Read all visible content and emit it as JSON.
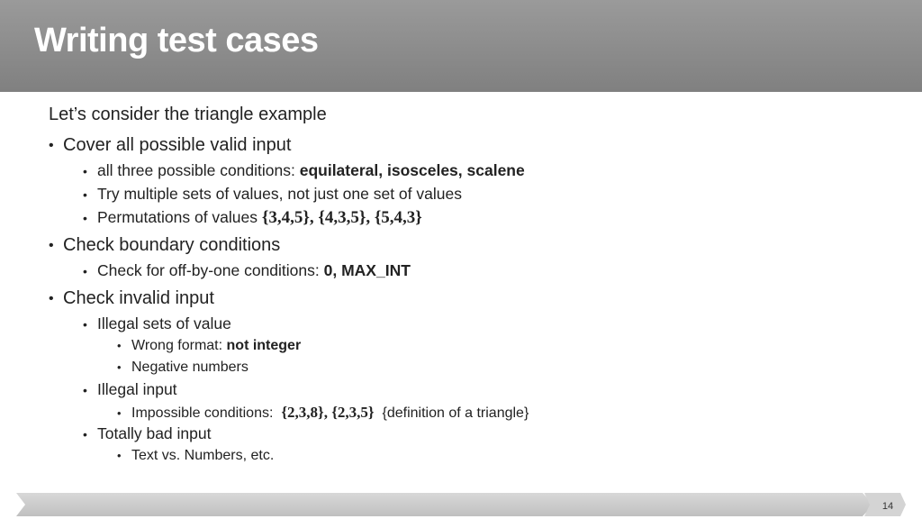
{
  "slide": {
    "title": "Writing test cases",
    "page_number": "14"
  },
  "content": {
    "intro": "Let’s consider the triangle example",
    "items": [
      {
        "text": "Cover all possible valid input"
      },
      {
        "text": "all three possible conditions: ",
        "bold": "equilateral, isosceles, scalene"
      },
      {
        "text": "Try multiple sets of values, not just one set of values"
      },
      {
        "text": "Permutations of values ",
        "bold": "{3,4,5}, {4,3,5}, {5,4,3}"
      },
      {
        "text": "Check boundary conditions"
      },
      {
        "text": "Check for off-by-one conditions: ",
        "bold": "0, MAX_INT"
      },
      {
        "text": "Check invalid input"
      },
      {
        "text": "Illegal sets of value"
      },
      {
        "text": "Wrong format: ",
        "bold": "not integer"
      },
      {
        "text": "Negative numbers"
      },
      {
        "text": "Illegal input"
      },
      {
        "text": "Impossible conditions:  ",
        "bold": "{2,3,8}, {2,3,5}",
        "suffix": "  {definition of a triangle}"
      },
      {
        "text": "Totally bad input"
      },
      {
        "text": "Text vs. Numbers, etc."
      }
    ]
  }
}
